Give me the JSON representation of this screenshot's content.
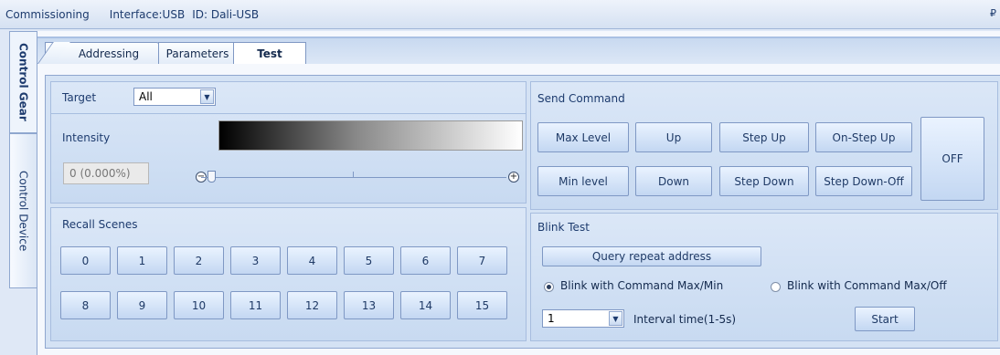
{
  "titlebar": {
    "mode": "Commissioning",
    "interface": "Interface:USB",
    "id": "ID: Dali-USB",
    "pin": "₽"
  },
  "sidetabs": {
    "control_gear": "Control Gear",
    "control_device": "Control Device"
  },
  "tabs": {
    "addressing": "Addressing",
    "parameters": "Parameters",
    "test": "Test"
  },
  "target": {
    "label": "Target",
    "value": "All"
  },
  "intensity": {
    "label": "Intensity",
    "value": "0 (0.000%)",
    "level": 0,
    "minus": "−",
    "plus": "+"
  },
  "recall": {
    "label": "Recall Scenes",
    "scenes": [
      "0",
      "1",
      "2",
      "3",
      "4",
      "5",
      "6",
      "7",
      "8",
      "9",
      "10",
      "11",
      "12",
      "13",
      "14",
      "15"
    ]
  },
  "send_command": {
    "label": "Send Command",
    "max_level": "Max Level",
    "up": "Up",
    "step_up": "Step Up",
    "on_step_up": "On-Step Up",
    "min_level": "Min level",
    "down": "Down",
    "step_down": "Step Down",
    "step_down_off": "Step Down-Off",
    "off": "OFF"
  },
  "blink": {
    "label": "Blink Test",
    "query_repeat": "Query repeat address",
    "opt_max_min": "Blink with Command Max/Min",
    "opt_max_off": "Blink with Command Max/Off",
    "selected": "max_min",
    "interval_value": "1",
    "interval_label": "Interval time(1-5s)",
    "start": "Start"
  }
}
